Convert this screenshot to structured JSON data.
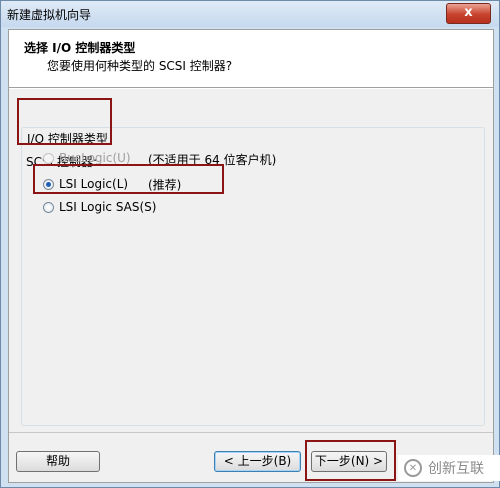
{
  "window": {
    "title": "新建虚拟机向导",
    "close_label": "x"
  },
  "header": {
    "title": "选择 I/O 控制器类型",
    "subtitle": "您要使用何种类型的 SCSI 控制器?"
  },
  "group": {
    "title": "I/O 控制器类型",
    "scsi_label": "SCSI 控制器:"
  },
  "options": [
    {
      "label": "BusLogic(U)",
      "note": "(不适用于 64 位客户机)",
      "selected": false,
      "enabled": false
    },
    {
      "label": "LSI Logic(L)",
      "note": "(推荐)",
      "selected": true,
      "enabled": true
    },
    {
      "label": "LSI Logic SAS(S)",
      "note": "",
      "selected": false,
      "enabled": true
    }
  ],
  "footer": {
    "help": "帮助",
    "back": "< 上一步(B)",
    "next": "下一步(N) >"
  },
  "watermark": {
    "text": "创新互联"
  },
  "colors": {
    "highlight_box": "#8b1414",
    "accent": "#1e5fb4"
  }
}
